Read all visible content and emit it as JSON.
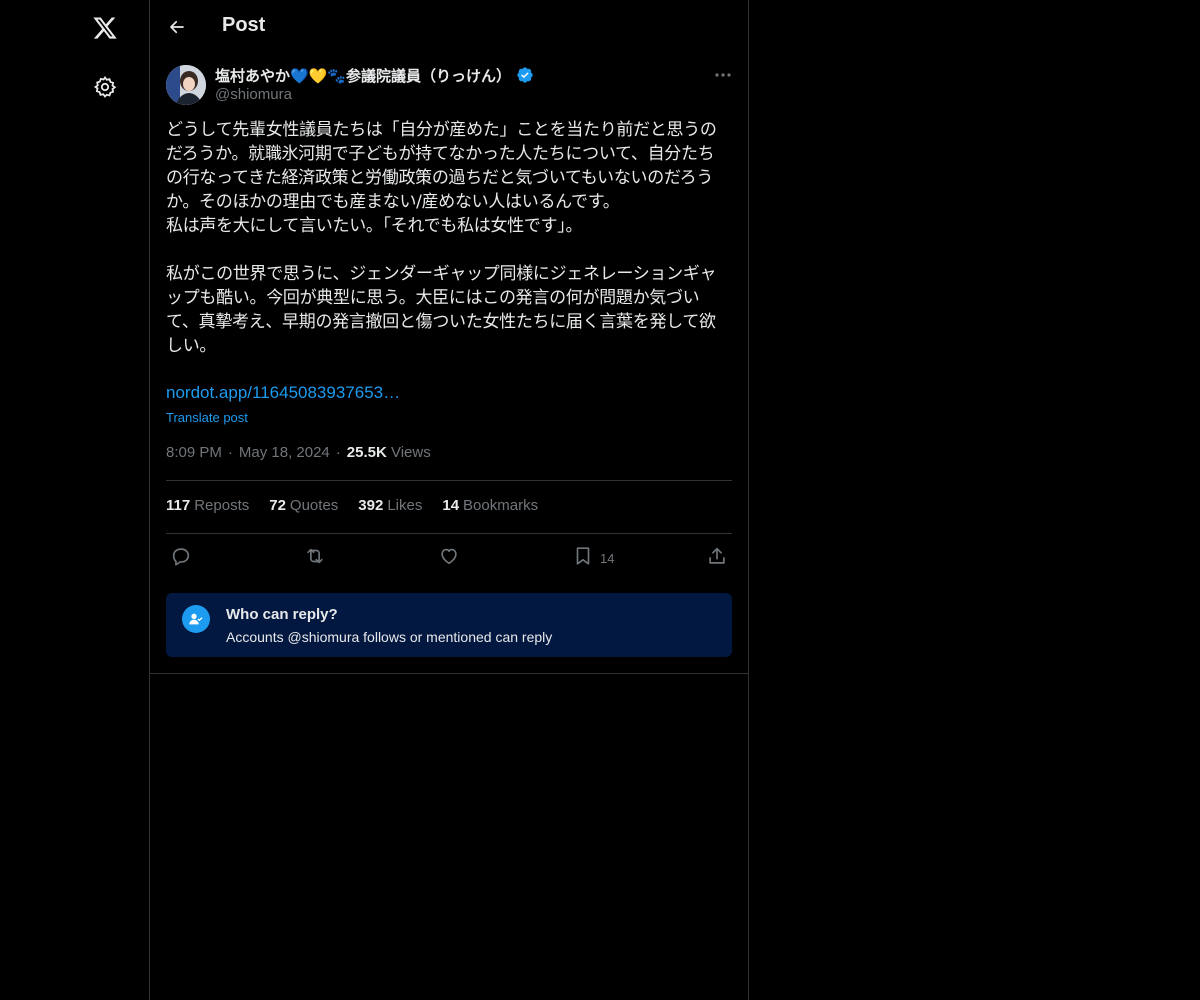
{
  "header": {
    "title": "Post"
  },
  "author": {
    "name": "塩村あやか💙💛🐾参議院議員（りっけん）",
    "handle": "@shiomura"
  },
  "post": {
    "text": "どうして先輩女性議員たちは「自分が産めた」ことを当たり前だと思うの\nだろうか。就職氷河期で子どもが持てなかった人たちについて、自分たち\nの行なってきた経済政策と労働政策の過ちだと気づいてもいないのだろう\nか。そのほかの理由でも産まない/産めない人はいるんです。\n私は声を大にして言いたい。「それでも私は女性です」。\n\n私がこの世界で思うに、ジェンダーギャップ同様にジェネレーションギャ\nップも酷い。今回が典型に思う。大臣にはこの発言の何が問題か気づい\nて、真摯考え、早期の発言撤回と傷ついた女性たちに届く言葉を発して欲\nしい。",
    "link": "nordot.app/11645083937653…",
    "translate": "Translate post",
    "time": "8:09 PM",
    "date": "May 18, 2024",
    "views_count": "25.5K",
    "views_label": "Views",
    "dot": "·"
  },
  "stats": {
    "reposts_count": "117",
    "reposts_label": "Reposts",
    "quotes_count": "72",
    "quotes_label": "Quotes",
    "likes_count": "392",
    "likes_label": "Likes",
    "bookmarks_count": "14",
    "bookmarks_label": "Bookmarks"
  },
  "actions": {
    "bookmark_count": "14"
  },
  "reply_restriction": {
    "title": "Who can reply?",
    "subtitle": "Accounts @shiomura follows or mentioned can reply"
  },
  "colors": {
    "background": "#000000",
    "accent": "#1d9bf0",
    "secondary_text": "#71767b",
    "divider": "#2f3336",
    "reply_box": "#031840"
  },
  "icons": [
    "x-logo-icon",
    "gear-icon",
    "back-arrow-icon",
    "verified-badge-icon",
    "more-icon",
    "reply-icon",
    "repost-icon",
    "like-icon",
    "bookmark-icon",
    "share-icon",
    "mention-user-icon"
  ]
}
